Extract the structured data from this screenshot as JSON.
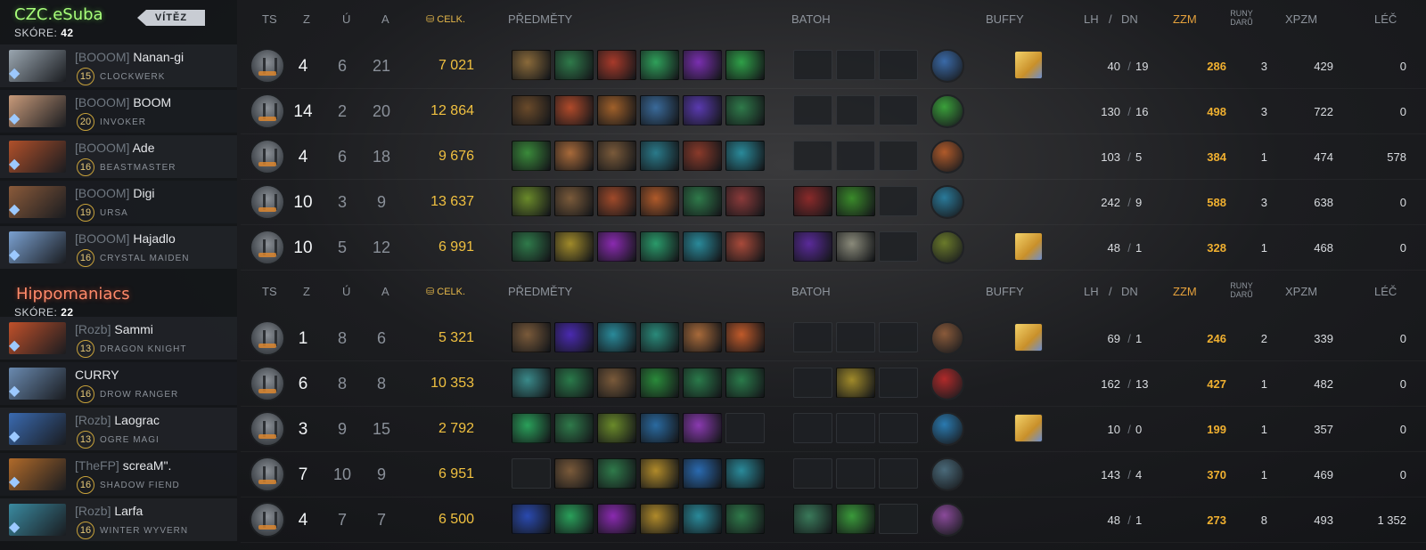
{
  "columns": {
    "ts": "TS",
    "z": "Z",
    "u": "Ú",
    "a": "A",
    "gold": "CELK.",
    "items": "PŘEDMĚTY",
    "backpack": "BATOH",
    "buffs": "BUFFY",
    "lh": "LH",
    "slash": "/",
    "dn": "DN",
    "zzm": "ZZM",
    "runes": "RUNY DARŮ",
    "xpm": "XPZM",
    "heal": "LÉČ"
  },
  "teams": [
    {
      "name": "CZC.eSuba",
      "winner_label": "VÍTĚZ",
      "score_label": "SKÓRE:",
      "score": "42",
      "players": [
        {
          "tag": "[BOOOM]",
          "name": "Nanan-gi",
          "level": "15",
          "hero": "CLOCKWERK",
          "k": "4",
          "d": "6",
          "a": "21",
          "gold": "7 021",
          "items": [
            "#8a6a3a",
            "#2f7a4a",
            "#a83a2a",
            "#2fa05a",
            "#7a2fb0",
            "#2fa048"
          ],
          "backpack": [
            "",
            "",
            ""
          ],
          "neutral": "#3a6aa8",
          "buff": true,
          "lh": "40",
          "dn": "19",
          "zzm": "286",
          "runes": "3",
          "xpm": "429",
          "heal": "0",
          "portrait": "#9aa6b0"
        },
        {
          "tag": "[BOOOM]",
          "name": "BOOM",
          "level": "20",
          "hero": "INVOKER",
          "k": "14",
          "d": "2",
          "a": "20",
          "gold": "12 864",
          "items": [
            "#6a4a2a",
            "#b04a2a",
            "#a0602a",
            "#3a6a9a",
            "#5a3ab0",
            "#2f7a4a"
          ],
          "backpack": [
            "",
            "",
            ""
          ],
          "neutral": "#3aa03a",
          "buff": false,
          "lh": "130",
          "dn": "16",
          "zzm": "498",
          "runes": "3",
          "xpm": "722",
          "heal": "0",
          "portrait": "#c89a7a"
        },
        {
          "tag": "[BOOOM]",
          "name": "Ade",
          "level": "16",
          "hero": "BEASTMASTER",
          "k": "4",
          "d": "6",
          "a": "18",
          "gold": "9 676",
          "items": [
            "#3a8a3a",
            "#a86a3a",
            "#7a5a3a",
            "#2a7a8a",
            "#8a3a2a",
            "#2a8a9a"
          ],
          "backpack": [
            "",
            "",
            ""
          ],
          "neutral": "#b05a2a",
          "buff": false,
          "lh": "103",
          "dn": "5",
          "zzm": "384",
          "runes": "1",
          "xpm": "474",
          "heal": "578",
          "portrait": "#b0502a"
        },
        {
          "tag": "[BOOOM]",
          "name": "Digi",
          "level": "19",
          "hero": "URSA",
          "k": "10",
          "d": "3",
          "a": "9",
          "gold": "13 637",
          "items": [
            "#6a8a2a",
            "#7a5a3a",
            "#a04a2a",
            "#b05a2a",
            "#2f7a4a",
            "#8a3a3a"
          ],
          "backpack": [
            "#8a2a2a",
            "#3a8a2a",
            ""
          ],
          "neutral": "#2a7a9a",
          "buff": false,
          "lh": "242",
          "dn": "9",
          "zzm": "588",
          "runes": "3",
          "xpm": "638",
          "heal": "0",
          "portrait": "#8a5a3a"
        },
        {
          "tag": "[BOOOM]",
          "name": "Hajadlo",
          "level": "16",
          "hero": "CRYSTAL MAIDEN",
          "k": "10",
          "d": "5",
          "a": "12",
          "gold": "6 991",
          "items": [
            "#2f7a4a",
            "#a08a2a",
            "#8a2ab0",
            "#2a9a6a",
            "#2a8a9a",
            "#a84a3a"
          ],
          "backpack": [
            "#5a2a9a",
            "#8a8a7a",
            ""
          ],
          "neutral": "#6a7a2a",
          "buff": true,
          "lh": "48",
          "dn": "1",
          "zzm": "328",
          "runes": "1",
          "xpm": "468",
          "heal": "0",
          "portrait": "#7aa0d0"
        }
      ]
    },
    {
      "name": "Hippomaniacs",
      "winner_label": "",
      "score_label": "SKÓRE:",
      "score": "22",
      "players": [
        {
          "tag": "[Rozb]",
          "name": "Sammi",
          "level": "13",
          "hero": "DRAGON KNIGHT",
          "k": "1",
          "d": "8",
          "a": "6",
          "gold": "5 321",
          "items": [
            "#7a5a3a",
            "#4a2ab0",
            "#2a8a9a",
            "#2a8a7a",
            "#a86a3a",
            "#c05a2a"
          ],
          "backpack": [
            "",
            "",
            ""
          ],
          "neutral": "#8a5a3a",
          "buff": true,
          "lh": "69",
          "dn": "1",
          "zzm": "246",
          "runes": "2",
          "xpm": "339",
          "heal": "0",
          "portrait": "#c0502a"
        },
        {
          "tag": "",
          "name": "CURRY",
          "level": "16",
          "hero": "DROW RANGER",
          "k": "6",
          "d": "8",
          "a": "8",
          "gold": "10 353",
          "items": [
            "#3a8a8a",
            "#2a7a4a",
            "#7a5a3a",
            "#2a8a3a",
            "#2a7a4a",
            "#2a7a4a"
          ],
          "backpack": [
            "",
            "#a08a2a",
            ""
          ],
          "neutral": "#b02a2a",
          "buff": false,
          "lh": "162",
          "dn": "13",
          "zzm": "427",
          "runes": "1",
          "xpm": "482",
          "heal": "0",
          "portrait": "#6a8ab0"
        },
        {
          "tag": "[Rozb]",
          "name": "Laograc",
          "level": "13",
          "hero": "OGRE MAGI",
          "k": "3",
          "d": "9",
          "a": "15",
          "gold": "2 792",
          "items": [
            "#2aa05a",
            "#2f7a4a",
            "#6a8a2a",
            "#2a6aa0",
            "#8a3ab0",
            ""
          ],
          "backpack": [
            "",
            "",
            ""
          ],
          "neutral": "#2a7ab0",
          "buff": true,
          "lh": "10",
          "dn": "0",
          "zzm": "199",
          "runes": "1",
          "xpm": "357",
          "heal": "0",
          "portrait": "#3a6ab0"
        },
        {
          "tag": "[TheFP]",
          "name": "screaM\".",
          "level": "16",
          "hero": "SHADOW FIEND",
          "k": "7",
          "d": "10",
          "a": "9",
          "gold": "6 951",
          "items": [
            "",
            "#7a5a3a",
            "#2f7a4a",
            "#b08a2a",
            "#2a6ab0",
            "#2a8a9a"
          ],
          "backpack": [
            "",
            "",
            ""
          ],
          "neutral": "#4a6a7a",
          "buff": false,
          "lh": "143",
          "dn": "4",
          "zzm": "370",
          "runes": "1",
          "xpm": "469",
          "heal": "0",
          "portrait": "#b06a2a"
        },
        {
          "tag": "[Rozb]",
          "name": "Larfa",
          "level": "16",
          "hero": "WINTER WYVERN",
          "k": "4",
          "d": "7",
          "a": "7",
          "gold": "6 500",
          "items": [
            "#2a4ab0",
            "#2aa05a",
            "#8a2ab0",
            "#b08a2a",
            "#2a8a9a",
            "#2f7a4a"
          ],
          "backpack": [
            "#3a7a5a",
            "#3a9a3a",
            ""
          ],
          "neutral": "#8a4a9a",
          "buff": false,
          "lh": "48",
          "dn": "1",
          "zzm": "273",
          "runes": "8",
          "xpm": "493",
          "heal": "1 352",
          "portrait": "#3a8aa0"
        }
      ]
    }
  ]
}
